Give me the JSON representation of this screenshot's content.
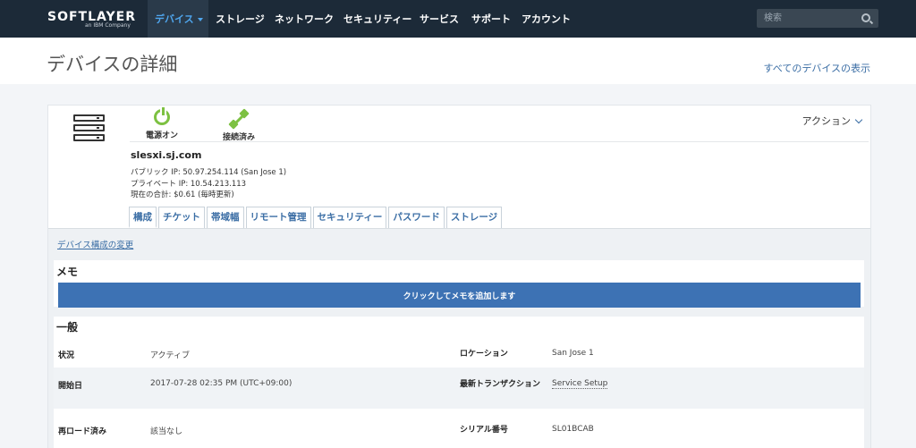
{
  "brand": {
    "logo": "SOFTLAYER",
    "sub": "an IBM Company"
  },
  "nav": {
    "items": [
      {
        "label": "デバイス",
        "active": true
      },
      {
        "label": "ストレージ"
      },
      {
        "label": "ネットワーク"
      },
      {
        "label": "セキュリティー"
      },
      {
        "label": "サービス"
      },
      {
        "label": "サポート"
      },
      {
        "label": "アカウント"
      }
    ],
    "search_placeholder": "検索"
  },
  "header": {
    "title": "デバイスの詳細",
    "all_devices_link": "すべてのデバイスの表示"
  },
  "device": {
    "power_status": "電源オン",
    "connection_status": "接続済み",
    "action_label": "アクション",
    "hostname": "slesxi.sj.com",
    "public_ip": "パブリック IP: 50.97.254.114 (San Jose 1)",
    "private_ip": "プライベート IP: 10.54.213.113",
    "current_total": "現在の合計: $0.61 (毎時更新)"
  },
  "tabs": [
    "構成",
    "チケット",
    "帯域幅",
    "リモート管理",
    "セキュリティー",
    "パスワード",
    "ストレージ"
  ],
  "config": {
    "change_link": "デバイス構成の変更",
    "memo_title": "メモ",
    "memo_button": "クリックしてメモを追加します",
    "general_title": "一般",
    "rows": [
      {
        "label1": "状況",
        "value1": "アクティブ",
        "label2": "ロケーション",
        "value2": "San Jose 1"
      },
      {
        "label1": "開始日",
        "value1": "2017-07-28 02:35 PM (UTC+09:00)",
        "label2": "最新トランザクション",
        "value2": "Service Setup"
      },
      {
        "label1": "再ロード済み",
        "value1": "該当なし",
        "label2": "シリアル番号",
        "value2": "SL01BCAB"
      }
    ]
  },
  "colors": {
    "nav_bg": "#1c2a38",
    "accent": "#3d72b4",
    "status_green": "#7dc142",
    "link": "#3b6ea5"
  }
}
